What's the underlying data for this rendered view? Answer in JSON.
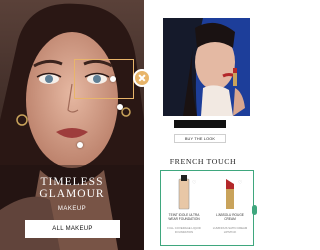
{
  "left": {
    "headline_line1": "TIMELESS",
    "headline_line2": "GLAMOUR",
    "subtitle": "MAKEUP",
    "cta": "ALL MAKEUP"
  },
  "right": {
    "shop_label": "BUY THE LOOK",
    "section_title": "FRENCH TOUCH",
    "products": [
      {
        "name": "TEINT IDOLE ULTRA WEAR FOUNDATION",
        "desc": "FULL COVERAGE LIQUID FOUNDATION"
      },
      {
        "name": "L'ABSOLU ROUGE CREAM",
        "desc": "LUMINOUS SATIN CREAM LIPSTICK"
      }
    ]
  },
  "colors": {
    "accent": "#e8b56a",
    "product_border": "#3fa77e",
    "blue_bg": "#1d3e9a"
  }
}
